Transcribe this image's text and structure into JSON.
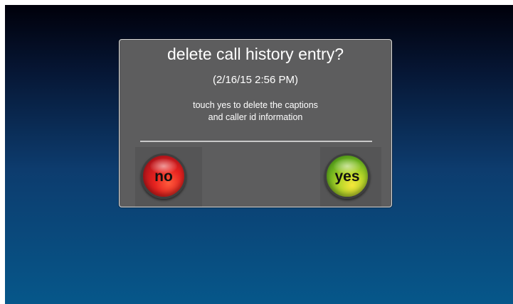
{
  "dialog": {
    "title": "delete call history entry?",
    "timestamp": "(2/16/15 2:56 PM)",
    "message_line1": "touch yes to delete the captions",
    "message_line2": "and caller id information"
  },
  "buttons": {
    "no_label": "no",
    "yes_label": "yes"
  },
  "colors": {
    "background_top": "#00000a",
    "background_bottom": "#06578a",
    "dialog_bg": "#5d5d5e",
    "no_button": "#e6221f",
    "yes_button": "#6fb41f"
  }
}
